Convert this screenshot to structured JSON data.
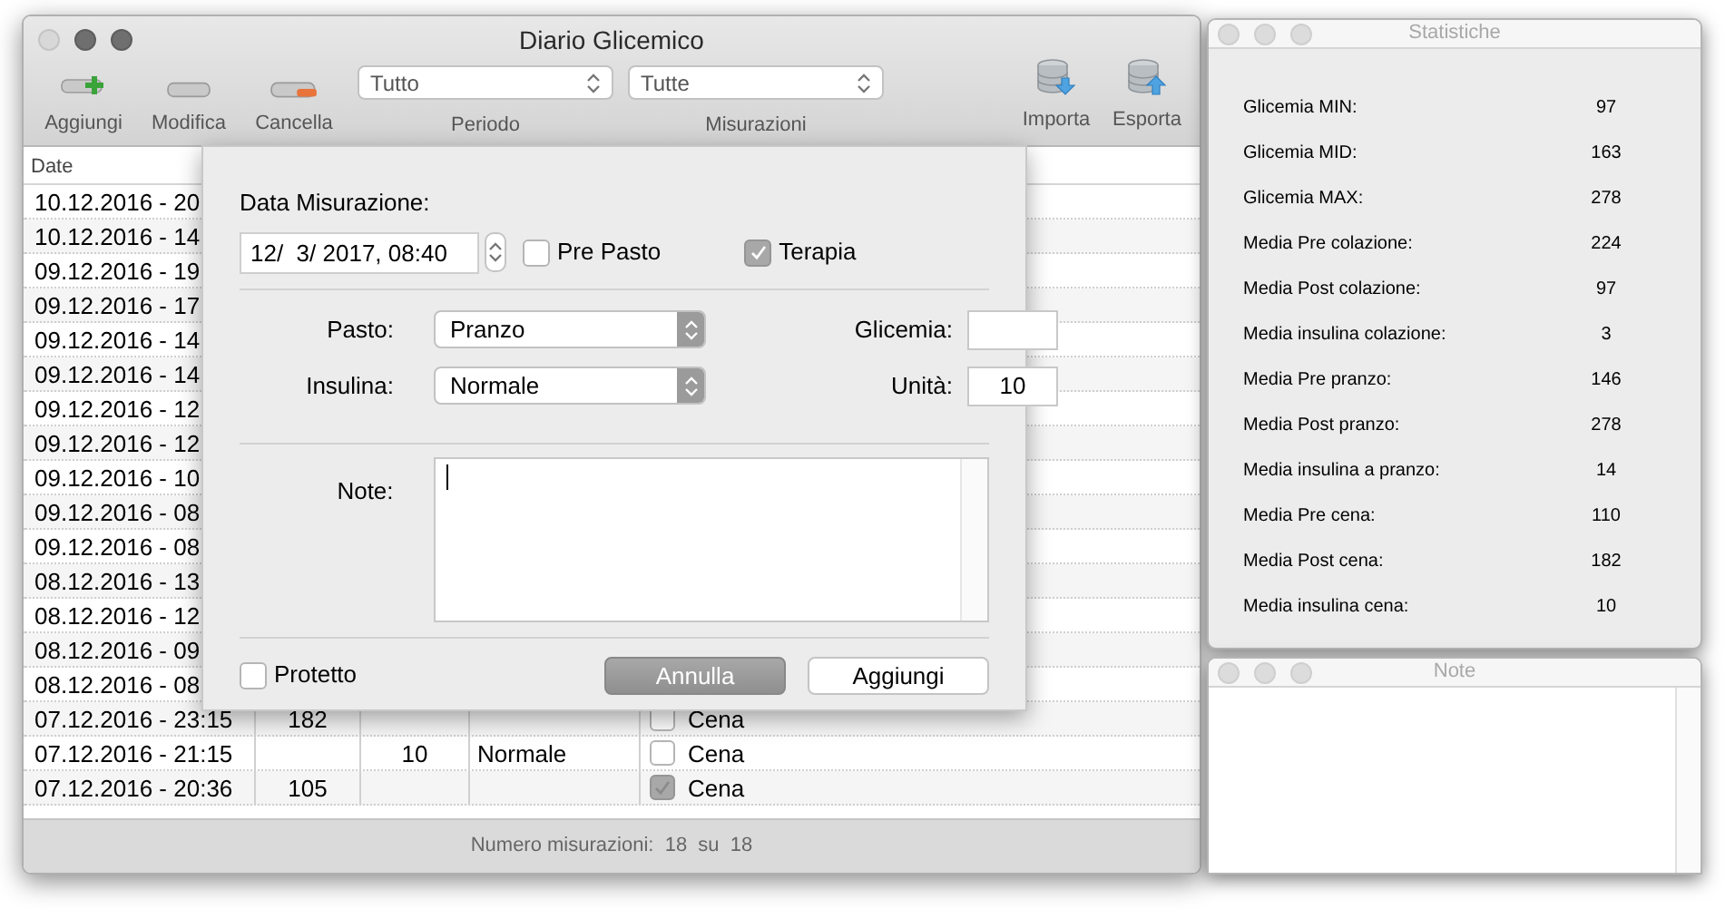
{
  "main_window": {
    "title": "Diario Glicemico"
  },
  "toolbar": {
    "left_buttons": [
      {
        "kind": "add",
        "label": "Aggiungi"
      },
      {
        "kind": "edit",
        "label": "Modifica"
      },
      {
        "kind": "delete",
        "label": "Cancella"
      }
    ],
    "filters": [
      {
        "value": "Tutto",
        "label": "Periodo"
      },
      {
        "value": "Tutte",
        "label": "Misurazioni"
      }
    ],
    "right_buttons": [
      {
        "kind": "import",
        "label": "Importa"
      },
      {
        "kind": "export",
        "label": "Esporta"
      }
    ]
  },
  "table": {
    "columns": [
      "Date"
    ],
    "rows": [
      {
        "date": "10.12.2016 - 20"
      },
      {
        "date": "10.12.2016 - 14"
      },
      {
        "date": "09.12.2016 - 19"
      },
      {
        "date": "09.12.2016 - 17"
      },
      {
        "date": "09.12.2016 - 14"
      },
      {
        "date": "09.12.2016 - 14"
      },
      {
        "date": "09.12.2016 - 12"
      },
      {
        "date": "09.12.2016 - 12"
      },
      {
        "date": "09.12.2016 - 10"
      },
      {
        "date": "09.12.2016 - 08"
      },
      {
        "date": "09.12.2016 - 08"
      },
      {
        "date": "08.12.2016 - 13"
      },
      {
        "date": "08.12.2016 - 12"
      },
      {
        "date": "08.12.2016 - 09"
      },
      {
        "date": "08.12.2016 - 08"
      },
      {
        "date": "07.12.2016 - 23:15",
        "column_2": "182",
        "checked": false,
        "column_6": "Cena"
      },
      {
        "date": "07.12.2016 - 21:15",
        "column_3": "10",
        "column_4": "Normale",
        "checked": false,
        "column_6": "Cena"
      },
      {
        "date": "07.12.2016 - 20:36",
        "column_2": "105",
        "checked": true,
        "column_6": "Cena"
      }
    ]
  },
  "status_bar": {
    "text": "Numero misurazioni:  18  su  18"
  },
  "sheet": {
    "date_label": "Data Misurazione:",
    "date_value": "12/  3/ 2017, 08:40",
    "pre_pasto": {
      "label": "Pre Pasto",
      "checked": false
    },
    "terapia": {
      "label": "Terapia",
      "checked": true
    },
    "pasto": {
      "label": "Pasto:",
      "value": "Pranzo"
    },
    "glicemia": {
      "label": "Glicemia:"
    },
    "insulina": {
      "label": "Insulina:",
      "value": "Normale"
    },
    "unita": {
      "label": "Unità:",
      "value": "10"
    },
    "note": {
      "label": "Note:"
    },
    "protetto": {
      "label": "Protetto",
      "checked": false
    },
    "buttons": [
      {
        "label": "Annulla",
        "highlighted": true
      },
      {
        "label": "Aggiungi",
        "highlighted": false
      }
    ]
  },
  "statistics_window": {
    "title": "Statistiche",
    "rows": [
      {
        "label": "Glicemia MIN:",
        "value": "97"
      },
      {
        "label": "Glicemia MID:",
        "value": "163"
      },
      {
        "label": "Glicemia MAX:",
        "value": "278"
      },
      {
        "label": "Media Pre colazione:",
        "value": "224"
      },
      {
        "label": "Media Post colazione:",
        "value": "97"
      },
      {
        "label": "Media insulina colazione:",
        "value": "3"
      },
      {
        "label": "Media Pre pranzo:",
        "value": "146"
      },
      {
        "label": "Media Post pranzo:",
        "value": "278"
      },
      {
        "label": "Media insulina a pranzo:",
        "value": "14"
      },
      {
        "label": "Media Pre cena:",
        "value": "110"
      },
      {
        "label": "Media Post cena:",
        "value": "182"
      },
      {
        "label": "Media insulina cena:",
        "value": "10"
      }
    ]
  },
  "notes_window": {
    "title": "Note"
  }
}
